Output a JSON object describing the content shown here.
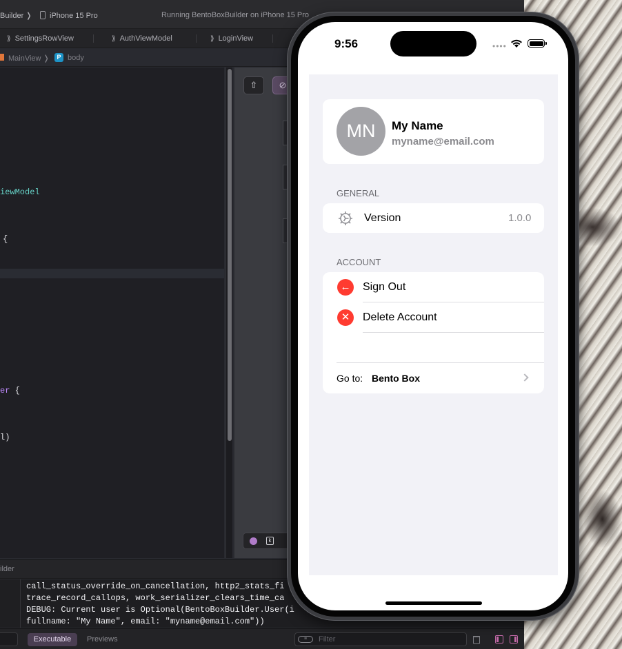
{
  "xcode": {
    "scheme": "Builder ❭",
    "device": "iPhone 15 Pro",
    "run_status": "Running BentoBoxBuilder on iPhone 15 Pro",
    "tabs": [
      {
        "label": "SettingsRowView"
      },
      {
        "label": "AuthViewModel"
      },
      {
        "label": "LoginView"
      }
    ],
    "jumpbar": {
      "view": "MainView ❭",
      "badge": "P",
      "symbol": "body"
    },
    "code": {
      "line1": "iewModel",
      "line2": "{",
      "line3_a": "er",
      "line3_b": " {",
      "line4": "l)"
    },
    "canvas": {
      "pin_glyph": "⇧",
      "variant_glyph": "⊘",
      "select_glyph": "k"
    },
    "debug": {
      "header": "ilder",
      "console": [
        "call_status_override_on_cancellation, http2_stats_fi",
        "trace_record_callops, work_serializer_clears_time_ca",
        "DEBUG: Current user is Optional(BentoBoxBuilder.User(i",
        "fullname: \"My Name\", email: \"myname@email.com\"))"
      ],
      "executable_tab": "Executable",
      "previews_tab": "Previews",
      "filter_placeholder": "Filter"
    }
  },
  "simulator": {
    "status_bar": {
      "time": "9:56",
      "dots": "••••"
    },
    "profile": {
      "initials": "MN",
      "full_name": "My Name",
      "email": "myname@email.com"
    },
    "general": {
      "header": "GENERAL",
      "version_label": "Version",
      "version_value": "1.0.0"
    },
    "account": {
      "header": "ACCOUNT",
      "sign_out_label": "Sign Out",
      "delete_label": "Delete Account",
      "goto_label": "Go to:",
      "goto_target": "Bento Box"
    },
    "icons": {
      "sign_out_glyph": "←",
      "delete_glyph": "✕"
    },
    "colors": {
      "destructive": "#ff3b30",
      "avatar": "#a3a3a7",
      "grouped_background": "#f2f2f7"
    }
  }
}
